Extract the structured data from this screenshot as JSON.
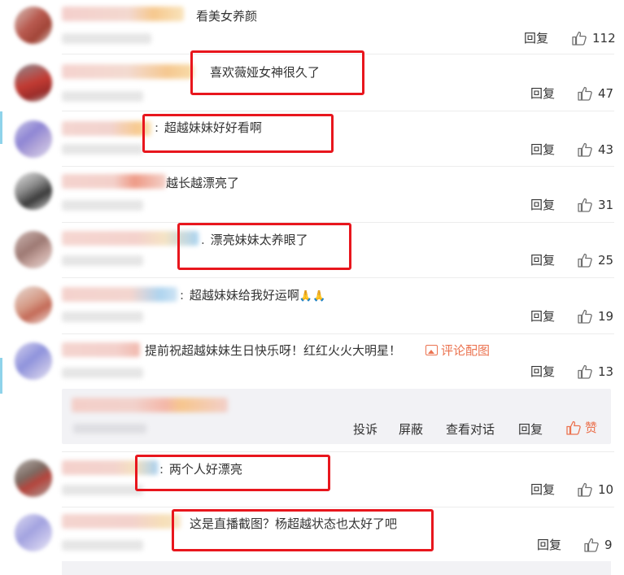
{
  "comments": [
    {
      "text": "看美女养颜",
      "reply_label": "回复",
      "likes": "112"
    },
    {
      "text": "喜欢薇娅女神很久了",
      "reply_label": "回复",
      "likes": "47"
    },
    {
      "colon": ":",
      "text": "超越妹妹好好看啊",
      "reply_label": "回复",
      "likes": "43"
    },
    {
      "text": "越长越漂亮了",
      "reply_label": "回复",
      "likes": "31"
    },
    {
      "colon": ".",
      "text": "漂亮妹妹太养眼了",
      "reply_label": "回复",
      "likes": "25"
    },
    {
      "colon": ":",
      "text": "超越妹妹给我好运啊",
      "emoji": "🙏🙏",
      "reply_label": "回复",
      "likes": "19"
    },
    {
      "text": "提前祝超越妹妹生日快乐呀！红红火火大明星！",
      "pic_link": "评论配图",
      "reply_label": "回复",
      "likes": "13"
    },
    {
      "colon": ":",
      "text": "两个人好漂亮",
      "reply_label": "回复",
      "likes": "10"
    },
    {
      "text": "这是直播截图？杨超越状态也太好了吧",
      "reply_label": "回复",
      "likes": "9"
    }
  ],
  "reply_area": {
    "report": "投诉",
    "block": "屏蔽",
    "view_conversation": "查看对话",
    "reply": "回复",
    "praise": "赞"
  },
  "colors": {
    "highlight_box": "#e8161d",
    "accent_orange": "#eb7350",
    "edge_bar": "#8fd3ea"
  },
  "icons": [
    "thumbs-up-icon",
    "image-icon"
  ]
}
